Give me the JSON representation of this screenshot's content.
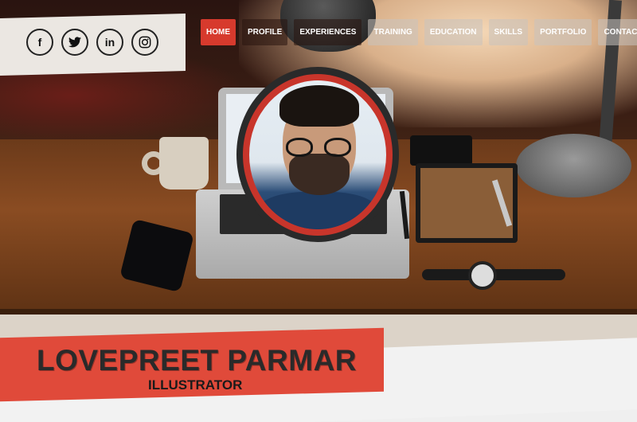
{
  "social": {
    "icons": [
      {
        "name": "facebook-icon",
        "glyph": "f"
      },
      {
        "name": "twitter-icon",
        "glyph": "🐦"
      },
      {
        "name": "linkedin-icon",
        "glyph": "in"
      },
      {
        "name": "instagram-icon",
        "glyph": "◎"
      }
    ]
  },
  "nav": {
    "items": [
      {
        "label": "HOME",
        "state": "active"
      },
      {
        "label": "PROFILE",
        "state": "dark"
      },
      {
        "label": "EXPERIENCES",
        "state": "dark"
      },
      {
        "label": "TRAINING",
        "state": "light"
      },
      {
        "label": "EDUCATION",
        "state": "light"
      },
      {
        "label": "SKILLS",
        "state": "light"
      },
      {
        "label": "PORTFOLIO",
        "state": "light"
      },
      {
        "label": "CONTACT",
        "state": "light"
      }
    ]
  },
  "profile": {
    "name": "LOVEPREET PARMAR",
    "role": "ILLUSTRATOR"
  },
  "colors": {
    "accent": "#d73a2d",
    "banner": "#e04a3a"
  }
}
